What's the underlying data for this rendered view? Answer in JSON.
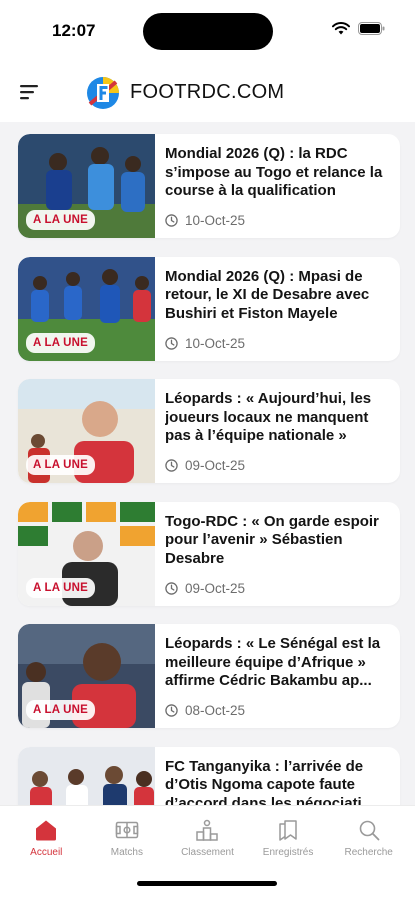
{
  "status": {
    "time": "12:07"
  },
  "header": {
    "brand": "FOOTRDC.COM"
  },
  "colors": {
    "accent": "#d4343c",
    "badge_text": "#c8102e",
    "background": "#f3f3f5"
  },
  "articles": [
    {
      "badge": "A LA UNE",
      "title": "Mondial 2026 (Q) : la RDC s’impose au Togo et relance la course à la qualification",
      "date": "10-Oct-25"
    },
    {
      "badge": "A LA UNE",
      "title": "Mondial 2026 (Q) : Mpasi de retour, le XI de Desabre avec Bushiri et Fiston Mayele",
      "date": "10-Oct-25"
    },
    {
      "badge": "A LA UNE",
      "title": "Léopards : « Aujourd’hui, les joueurs locaux ne manquent pas à l’équipe nationale »",
      "date": "09-Oct-25"
    },
    {
      "badge": "A LA UNE",
      "title": "Togo-RDC : « On garde espoir pour l’avenir » Sébastien Desabre",
      "date": "09-Oct-25"
    },
    {
      "badge": "A LA UNE",
      "title": "Léopards : « Le Sénégal est la meilleure équipe d’Afrique » affirme Cédric Bakambu ap...",
      "date": "08-Oct-25"
    },
    {
      "badge": "",
      "title": "FC Tanganyika : l’arrivée de d’Otis Ngoma capote faute d’accord dans les négociati",
      "date": ""
    }
  ],
  "tabbar": {
    "items": [
      {
        "label": "Accueil",
        "icon": "home-icon",
        "active": true
      },
      {
        "label": "Matchs",
        "icon": "pitch-icon",
        "active": false
      },
      {
        "label": "Classement",
        "icon": "podium-icon",
        "active": false
      },
      {
        "label": "Enregistrés",
        "icon": "bookmark-icon",
        "active": false
      },
      {
        "label": "Recherche",
        "icon": "search-icon",
        "active": false
      }
    ]
  }
}
